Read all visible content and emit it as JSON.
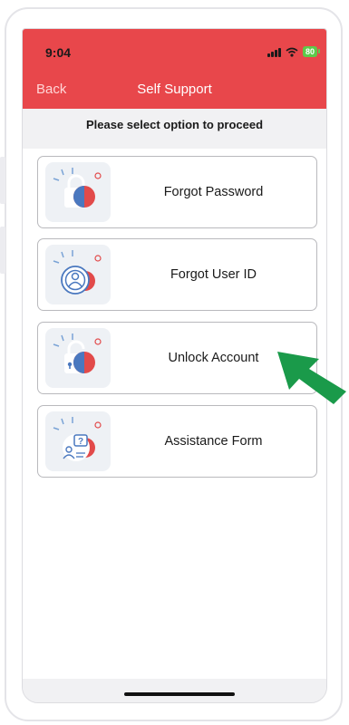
{
  "status_bar": {
    "time": "9:04",
    "battery": "80"
  },
  "nav": {
    "back_label": "Back",
    "title": "Self Support"
  },
  "prompt": "Please select option to proceed",
  "options": [
    {
      "label": "Forgot Password",
      "icon": "password-lock-icon"
    },
    {
      "label": "Forgot User ID",
      "icon": "user-id-icon"
    },
    {
      "label": "Unlock Account",
      "icon": "unlock-account-icon"
    },
    {
      "label": "Assistance Form",
      "icon": "assistance-form-icon"
    }
  ],
  "colors": {
    "header": "#e8474b",
    "accent_blue": "#5b86c5",
    "accent_red": "#e24a4a",
    "pointer_arrow": "#1a9a4a",
    "battery": "#5ec94a"
  }
}
